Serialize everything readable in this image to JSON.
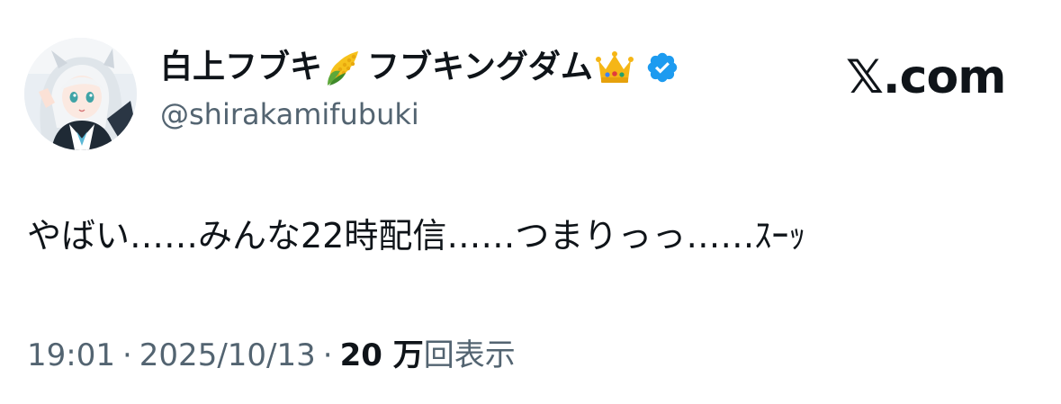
{
  "tweet": {
    "author": {
      "display_name_part1": "白上フブキ",
      "emoji_1": "corn-emoji",
      "display_name_part2": "フブキングダム",
      "emoji_2": "crown-emoji",
      "verified_badge": "verified-badge-icon",
      "handle": "@shirakamifubuki",
      "avatar": "avatar-image"
    },
    "brand": "𝕏.com",
    "text": "やばい……みんな22時配信……つまりっっ……ｽｰｯ",
    "meta": {
      "time": "19:01",
      "separator": "·",
      "date": "2025/10/13",
      "views_count": "20 万",
      "views_label": "回表示"
    }
  },
  "colors": {
    "primary_text": "#0f1419",
    "secondary_text": "#536471",
    "verified_blue": "#1d9bf0",
    "background": "#ffffff"
  }
}
